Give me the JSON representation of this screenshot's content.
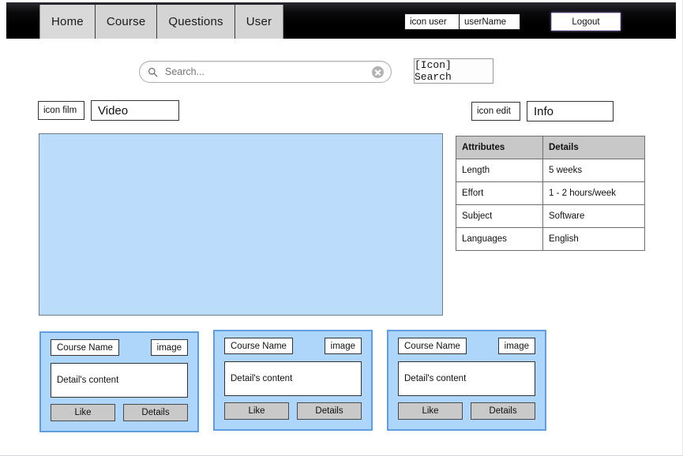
{
  "navbar": {
    "tabs": [
      {
        "label": "Home",
        "active": true
      },
      {
        "label": "Course",
        "active": false
      },
      {
        "label": "Questions",
        "active": false
      },
      {
        "label": "User",
        "active": false
      }
    ],
    "user_icon_label": "icon user",
    "user_name": "userName",
    "logout_label": "Logout",
    "background_color": "#000000",
    "logout_border_color": "#c9b8f0"
  },
  "search": {
    "placeholder": "Search...",
    "value": "",
    "icon": "search-icon",
    "clear_icon": "clear-circle-icon",
    "action_label": "[Icon] Search"
  },
  "video_section": {
    "icon_label": "icon film",
    "title": "Video",
    "placeholder_color": "#bcdcfb"
  },
  "info_section": {
    "icon_label": "icon edit",
    "title": "Info"
  },
  "attributes_table": {
    "headers": [
      "Attributes",
      "Details"
    ],
    "header_background": "#c8c8c8",
    "rows": [
      [
        "Length",
        "5 weeks"
      ],
      [
        "Effort",
        "1 - 2 hours/week"
      ],
      [
        "Subject",
        "Software"
      ],
      [
        "Languages",
        "English"
      ]
    ]
  },
  "cards": {
    "card_background": "#aed6fa",
    "card_border": "#5f9fe0",
    "items": [
      {
        "title": "Course Name",
        "image_label": "image",
        "detail": "Detail's content",
        "like_label": "Like",
        "details_label": "Details"
      },
      {
        "title": "Course Name",
        "image_label": "image",
        "detail": "Detail's content",
        "like_label": "Like",
        "details_label": "Details"
      },
      {
        "title": "Course Name",
        "image_label": "image",
        "detail": "Detail's content",
        "like_label": "Like",
        "details_label": "Details"
      }
    ]
  }
}
